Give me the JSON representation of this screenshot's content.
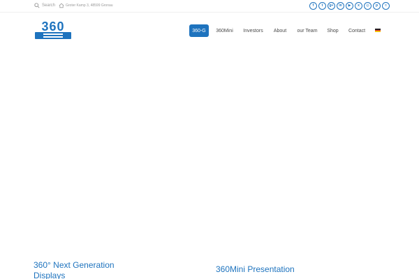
{
  "topbar": {
    "search_label": "Search",
    "address": "Groter Kamp 3, 48599 Gronau",
    "social_icons": [
      "facebook-icon",
      "twitter-icon",
      "google-plus-icon",
      "linkedin-icon",
      "youtube-icon",
      "xing-icon",
      "instagram-icon",
      "pinterest-icon",
      "rss-icon"
    ],
    "social_glyphs": [
      "f",
      "t",
      "g+",
      "in",
      "▶",
      "x",
      "◎",
      "p",
      "≈"
    ]
  },
  "logo": {
    "text": "360",
    "color": "#1e73be"
  },
  "nav": {
    "items": [
      {
        "label": "360-G",
        "active": true
      },
      {
        "label": "360Mini",
        "active": false
      },
      {
        "label": "Investors",
        "active": false
      },
      {
        "label": "About",
        "active": false
      },
      {
        "label": "our Team",
        "active": false
      },
      {
        "label": "Shop",
        "active": false
      },
      {
        "label": "Contact",
        "active": false
      }
    ],
    "language_flag": "de-flag-icon"
  },
  "content": {
    "card1_title": "360° Next Generation Displays",
    "card2_title": "360Mini Presentation"
  },
  "colors": {
    "accent": "#1e73be",
    "text": "#4a4a4a",
    "muted": "#9a9a9a"
  }
}
